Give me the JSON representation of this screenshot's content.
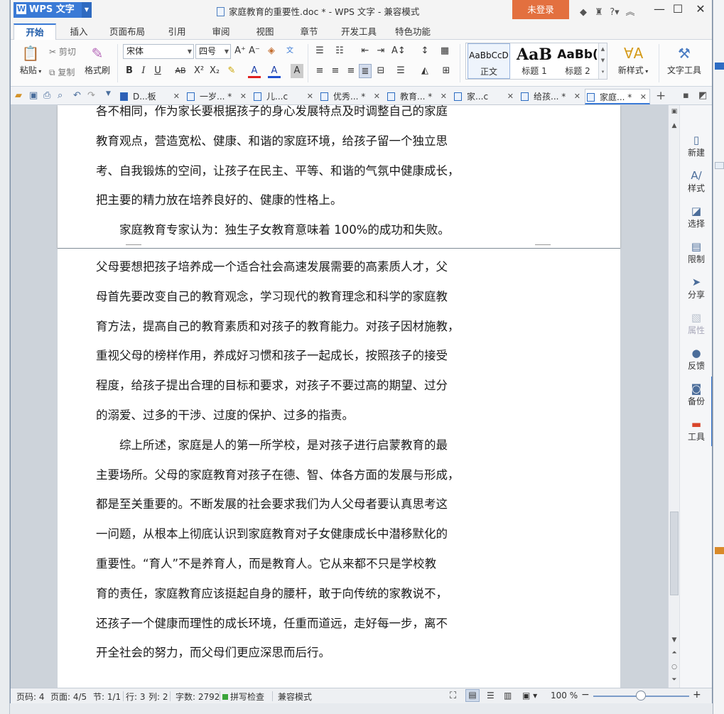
{
  "app": {
    "name": "WPS 文字"
  },
  "window": {
    "title": "家庭教育的重要性.doc * - WPS 文字 - 兼容模式",
    "login": "未登录"
  },
  "ribbon_tabs": [
    "开始",
    "插入",
    "页面布局",
    "引用",
    "审阅",
    "视图",
    "章节",
    "开发工具",
    "特色功能"
  ],
  "ribbon": {
    "paste": "粘贴",
    "cut": "剪切",
    "copy": "复制",
    "format_painter": "格式刷",
    "font_name": "宋体",
    "font_size": "四号",
    "styles": [
      {
        "preview": "AaBbCcD",
        "name": "正文"
      },
      {
        "preview": "AaB",
        "name": "标题 1"
      },
      {
        "preview": "AaBb(",
        "name": "标题 2"
      }
    ],
    "new_style": "新样式",
    "text_tools": "文字工具"
  },
  "doc_tabs": [
    {
      "label": "D...板",
      "active": false
    },
    {
      "label": "一岁... *",
      "active": false
    },
    {
      "label": "儿...c",
      "active": false
    },
    {
      "label": "优秀... *",
      "active": false
    },
    {
      "label": "教育... *",
      "active": false
    },
    {
      "label": "家...c",
      "active": false
    },
    {
      "label": "给孩... *",
      "active": false
    },
    {
      "label": "家庭... *",
      "active": true
    }
  ],
  "document": {
    "page1_lines": [
      "各不相同，作为家长要根据孩子的身心发展特点及时调整自己的家庭",
      "教育观点，营造宽松、健康、和谐的家庭环境，给孩子留一个独立思",
      "考、自我锻炼的空间，让孩子在民主、平等、和谐的气氛中健康成长，",
      "把主要的精力放在培养良好的、健康的性格上。",
      "　　家庭教育专家认为：独生子女教育意味着 100%的成功和失败。"
    ],
    "page2_lines": [
      "父母要想把孩子培养成一个适合社会高速发展需要的高素质人才，父",
      "母首先要改变自己的教育观念，学习现代的教育理念和科学的家庭教",
      "育方法，提高自己的教育素质和对孩子的教育能力。对孩子因材施教，",
      "重视父母的榜样作用，养成好习惯和孩子一起成长，按照孩子的接受",
      "程度，给孩子提出合理的目标和要求，对孩子不要过高的期望、过分",
      "的溺爱、过多的干涉、过度的保护、过多的指责。",
      "　　综上所述，家庭是人的第一所学校，是对孩子进行启蒙教育的最",
      "主要场所。父母的家庭教育对孩子在德、智、体各方面的发展与形成，",
      "都是至关重要的。不断发展的社会要求我们为人父母者要认真思考这",
      "一问题，从根本上彻底认识到家庭教育对子女健康成长中潜移默化的",
      "重要性。“育人”不是养育人，而是教育人。它从来都不只是学校教",
      "育的责任，家庭教育应该挺起自身的腰杆，敢于向传统的家教说不，",
      "还孩子一个健康而理性的成长环境，任重而道远，走好每一步，离不",
      "开全社会的努力，而父母们更应深思而后行。"
    ]
  },
  "side_panel": [
    {
      "label": "新建",
      "icon": "new-doc-icon",
      "disabled": false
    },
    {
      "label": "样式",
      "icon": "style-icon",
      "disabled": false
    },
    {
      "label": "选择",
      "icon": "select-icon",
      "disabled": false
    },
    {
      "label": "限制",
      "icon": "restrict-icon",
      "disabled": false
    },
    {
      "label": "分享",
      "icon": "share-icon",
      "disabled": false
    },
    {
      "label": "属性",
      "icon": "properties-icon",
      "disabled": true
    },
    {
      "label": "反馈",
      "icon": "feedback-icon",
      "disabled": false
    },
    {
      "label": "备份",
      "icon": "backup-icon",
      "disabled": false
    },
    {
      "label": "工具",
      "icon": "toolbox-icon",
      "disabled": false
    }
  ],
  "status": {
    "page_num": "页码: 4",
    "pages": "页面: 4/5",
    "section": "节: 1/1",
    "row": "行: 3",
    "col": "列: 2",
    "chars": "字数: 2792",
    "spell": "拼写检查",
    "compat": "兼容模式",
    "zoom": "100 %"
  },
  "colors": {
    "accent": "#3a7ad6",
    "login": "#e3703f",
    "toolbox_red": "#d9452b"
  }
}
